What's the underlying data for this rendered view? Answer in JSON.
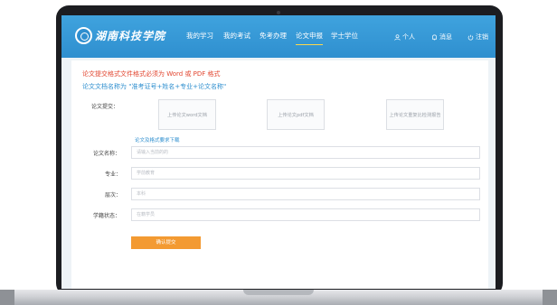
{
  "nav": {
    "logo": "湖南科技学院",
    "items": [
      "我的学习",
      "我的考试",
      "免考办理",
      "论文申报",
      "学士学位"
    ],
    "active_index": 3,
    "right": [
      "个人",
      "消息",
      "注销"
    ]
  },
  "notices": {
    "format": "论文提交格式文件格式必须为 Word 或 PDF 格式",
    "naming": "论文文档名称为 \"准考证号+姓名+专业+论文名称\""
  },
  "form": {
    "submit_label": "论文提交：",
    "upload_word": "上传论文word文档",
    "upload_pdf": "上传论文pdf文档",
    "upload_check": "上传论文重复比检测报告",
    "download_link": "论文及格式要求下载",
    "title_label": "论文名称：",
    "title_placeholder": "请输入当前的的",
    "major_label": "专业：",
    "major_placeholder": "学前教育",
    "level_label": "层次：",
    "level_placeholder": "本科",
    "status_label": "学籍状态：",
    "status_placeholder": "在籍学员",
    "confirm_button": "确认提交"
  },
  "colors": {
    "nav": "#2f8fcf",
    "active_underline": "#ffd84a",
    "notice_red": "#e2452f",
    "notice_blue": "#2f8fcf",
    "submit_button": "#f39a32"
  }
}
